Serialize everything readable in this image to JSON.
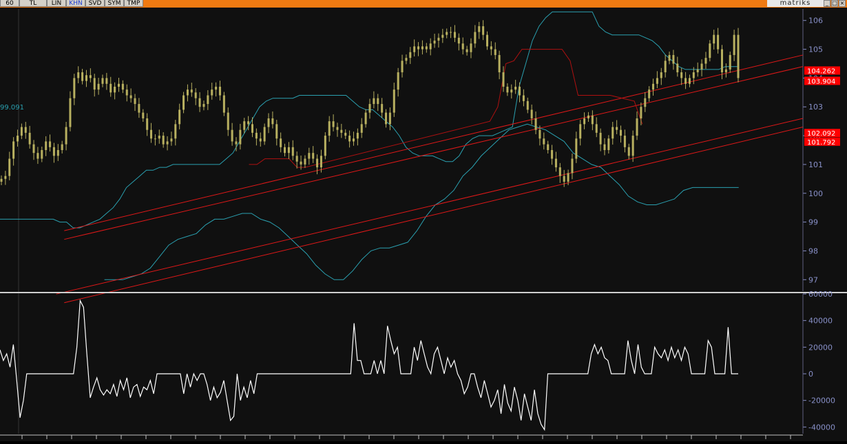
{
  "toolbar": {
    "tabs": [
      {
        "label": "60",
        "active": false
      },
      {
        "label": "TL",
        "active": false
      },
      {
        "label": "LIN",
        "active": false
      },
      {
        "label": "KHN",
        "active": true
      },
      {
        "label": "SVD",
        "active": false
      },
      {
        "label": "SYM",
        "active": false
      },
      {
        "label": "TMP",
        "active": false
      }
    ],
    "brand": "matriks"
  },
  "colors": {
    "background": "#101010",
    "toolbar": "#f07a12",
    "price": "#b8b060",
    "channel": "#e01818",
    "envelope": "#2aa0b0",
    "oscillator": "#ffffff",
    "axis_text": "#8890c8",
    "marker_bg": "#ff0000"
  },
  "chart_data": [
    {
      "type": "candlestick",
      "y_axis": {
        "ylim": [
          96.6,
          106.4
        ],
        "ticks": [
          {
            "value": 97,
            "label": "97"
          },
          {
            "value": 98,
            "label": "98"
          },
          {
            "value": 99,
            "label": "99"
          },
          {
            "value": 100,
            "label": "100"
          },
          {
            "value": 101,
            "label": "101"
          },
          {
            "value": 102,
            "label": "102"
          },
          {
            "value": 103,
            "label": "103"
          },
          {
            "value": 104,
            "label": "104"
          },
          {
            "value": 105,
            "label": "105"
          },
          {
            "value": 106,
            "label": "106"
          }
        ]
      },
      "last_price_markers": [
        {
          "value": 104.262,
          "label": "104.262"
        },
        {
          "value": 103.904,
          "label": "103.904"
        },
        {
          "value": 102.092,
          "label": "102.092"
        },
        {
          "value": 101.792,
          "label": "101.792"
        }
      ],
      "left_label": {
        "value": 103.0,
        "label": "99.091"
      },
      "close": [
        100.5,
        100.6,
        101.2,
        101.8,
        102.0,
        102.3,
        102.1,
        101.7,
        101.4,
        101.2,
        101.5,
        101.8,
        101.6,
        101.3,
        101.5,
        101.7,
        102.3,
        103.3,
        104.0,
        104.2,
        103.9,
        104.1,
        104.0,
        103.6,
        103.8,
        104.0,
        103.8,
        103.5,
        103.7,
        103.8,
        103.6,
        103.4,
        103.3,
        103.1,
        102.8,
        102.6,
        102.2,
        101.9,
        101.9,
        102.0,
        101.7,
        101.8,
        101.9,
        102.4,
        102.9,
        103.4,
        103.6,
        103.5,
        103.3,
        103.0,
        103.1,
        103.4,
        103.6,
        103.7,
        103.4,
        102.8,
        102.2,
        101.8,
        101.7,
        102.2,
        102.5,
        102.4,
        102.1,
        101.9,
        101.8,
        102.3,
        102.6,
        102.4,
        101.9,
        101.6,
        101.4,
        101.6,
        101.3,
        101.1,
        101.0,
        101.2,
        101.4,
        101.2,
        100.9,
        101.3,
        102.0,
        102.5,
        102.3,
        102.2,
        102.1,
        102.0,
        101.8,
        101.9,
        102.1,
        102.4,
        102.8,
        103.1,
        103.3,
        103.1,
        102.8,
        102.4,
        102.8,
        103.6,
        104.2,
        104.6,
        104.7,
        104.9,
        105.1,
        105.0,
        105.1,
        105.0,
        105.2,
        105.3,
        105.4,
        105.5,
        105.6,
        105.6,
        105.4,
        105.2,
        105.0,
        104.9,
        105.2,
        105.6,
        105.8,
        105.5,
        105.1,
        105.0,
        104.8,
        104.2,
        103.7,
        103.5,
        103.6,
        103.7,
        103.4,
        103.2,
        102.9,
        102.6,
        102.2,
        101.9,
        101.7,
        101.5,
        101.2,
        100.9,
        100.6,
        100.4,
        100.7,
        101.2,
        101.9,
        102.4,
        102.6,
        102.7,
        102.4,
        102.1,
        101.7,
        101.5,
        101.9,
        102.3,
        102.2,
        102.0,
        101.6,
        101.3,
        102.0,
        102.6,
        103.0,
        103.3,
        103.6,
        103.8,
        104.0,
        104.2,
        104.6,
        104.8,
        104.5,
        104.2,
        104.0,
        103.8,
        104.0,
        104.2,
        104.3,
        104.5,
        104.7,
        105.2,
        105.5,
        105.0,
        104.2,
        104.3,
        104.8,
        105.5,
        104.0
      ],
      "envelope_upper": [
        99.1,
        99.1,
        99.1,
        99.1,
        99.1,
        99.1,
        99.1,
        99.1,
        99.1,
        99.0,
        99.0,
        98.8,
        98.8,
        98.9,
        99.0,
        99.1,
        99.3,
        99.5,
        99.8,
        100.2,
        100.4,
        100.6,
        100.8,
        100.8,
        100.9,
        100.9,
        101.0,
        101.0,
        101.0,
        101.0,
        101.0,
        101.0,
        101.0,
        101.0,
        101.2,
        101.4,
        101.8,
        102.2,
        102.6,
        103.0,
        103.2,
        103.3,
        103.3,
        103.3,
        103.3,
        103.4,
        103.4,
        103.4,
        103.4,
        103.4,
        103.4,
        103.4,
        103.4,
        103.2,
        103.0,
        102.9,
        102.9,
        102.7,
        102.5,
        102.3,
        102.0,
        101.6,
        101.4,
        101.3,
        101.3,
        101.3,
        101.2,
        101.1,
        101.1,
        101.3,
        101.7,
        101.9,
        102.0,
        102.0,
        102.0,
        102.1,
        102.2,
        102.3,
        103.7,
        104.5,
        105.3,
        105.8,
        106.1,
        106.3,
        106.3,
        106.3,
        106.3,
        106.3,
        106.3,
        106.3,
        105.8,
        105.6,
        105.5,
        105.5,
        105.5,
        105.5,
        105.5,
        105.4,
        105.3,
        105.1,
        104.8,
        104.6,
        104.4,
        104.3,
        104.3,
        104.3,
        104.3,
        104.3,
        104.3,
        104.4,
        104.4,
        104.4
      ],
      "envelope_lower": [
        97.0,
        97.0,
        97.0,
        97.1,
        97.2,
        97.4,
        97.8,
        98.2,
        98.4,
        98.5,
        98.6,
        98.9,
        99.1,
        99.1,
        99.2,
        99.3,
        99.3,
        99.1,
        99.0,
        98.8,
        98.5,
        98.2,
        97.9,
        97.5,
        97.2,
        97.0,
        97.0,
        97.3,
        97.7,
        98.0,
        98.1,
        98.1,
        98.2,
        98.3,
        98.7,
        99.2,
        99.6,
        99.8,
        100.1,
        100.6,
        100.9,
        101.3,
        101.6,
        101.9,
        102.2,
        102.3,
        102.4,
        102.3,
        102.2,
        102.0,
        101.8,
        101.4,
        101.2,
        101.0,
        100.9,
        100.6,
        100.3,
        99.9,
        99.7,
        99.6,
        99.6,
        99.7,
        99.8,
        100.1,
        100.2,
        100.2,
        100.2,
        100.2,
        100.2,
        100.2
      ],
      "channel_lines": [
        {
          "from": [
            0.08,
            98.7
          ],
          "to": [
            1.0,
            104.8
          ]
        },
        {
          "from": [
            0.08,
            98.4
          ],
          "to": [
            1.0,
            104.4
          ]
        },
        {
          "from": [
            0.07,
            96.5
          ],
          "to": [
            1.0,
            102.6
          ]
        },
        {
          "from": [
            0.08,
            96.2
          ],
          "to": [
            1.0,
            102.3
          ]
        }
      ],
      "stop_line": [
        [
          0.31,
          101.0
        ],
        [
          0.32,
          101.0
        ],
        [
          0.33,
          101.2
        ],
        [
          0.36,
          101.2
        ],
        [
          0.37,
          100.9
        ],
        [
          0.38,
          100.9
        ],
        [
          0.61,
          102.5
        ],
        [
          0.61,
          102.5
        ],
        [
          0.62,
          103.0
        ],
        [
          0.63,
          104.5
        ],
        [
          0.64,
          104.6
        ],
        [
          0.65,
          105.0
        ],
        [
          0.7,
          105.0
        ],
        [
          0.71,
          104.6
        ],
        [
          0.72,
          103.4
        ],
        [
          0.76,
          103.4
        ],
        [
          0.79,
          103.2
        ],
        [
          0.8,
          102.4
        ]
      ]
    },
    {
      "type": "line",
      "ylim": [
        -45000,
        60000
      ],
      "y_ticks": [
        {
          "value": 60000,
          "label": "60000"
        },
        {
          "value": 40000,
          "label": "40000"
        },
        {
          "value": 20000,
          "label": "20000"
        },
        {
          "value": 0,
          "label": "0"
        },
        {
          "value": -20000,
          "label": "-20000"
        },
        {
          "value": -40000,
          "label": "-40000"
        }
      ],
      "values": [
        18000,
        10000,
        15000,
        5000,
        22000,
        -5000,
        -33000,
        -20000,
        0,
        0,
        0,
        0,
        0,
        0,
        0,
        0,
        0,
        0,
        0,
        0,
        0,
        0,
        0,
        20000,
        55000,
        50000,
        15000,
        -18000,
        -10000,
        -3000,
        -12000,
        -16000,
        -12000,
        -15000,
        -8000,
        -17000,
        -5000,
        -12000,
        -3000,
        -18000,
        -10000,
        -8000,
        -17000,
        -10000,
        -12000,
        -5000,
        -15000,
        0,
        0,
        0,
        0,
        0,
        0,
        0,
        0,
        -15000,
        0,
        -10000,
        0,
        -5000,
        0,
        0,
        -8000,
        -20000,
        -10000,
        -18000,
        -14000,
        -5000,
        -20000,
        -35000,
        -32000,
        0,
        -20000,
        -10000,
        -18000,
        -5000,
        -15000,
        0,
        0,
        0,
        0,
        0,
        0,
        0,
        0,
        0,
        0,
        0,
        0,
        0,
        0,
        0,
        0,
        0,
        0,
        0,
        0,
        0,
        0,
        0,
        0,
        0,
        0,
        0,
        0,
        0,
        38000,
        10000,
        10000,
        0,
        0,
        0,
        10000,
        0,
        10000,
        0,
        36000,
        25000,
        15000,
        20000,
        0,
        0,
        0,
        0,
        20000,
        10000,
        25000,
        15000,
        5000,
        0,
        15000,
        20000,
        10000,
        0,
        12000,
        5000,
        10000,
        0,
        -5000,
        -15000,
        -10000,
        0,
        0,
        -10000,
        -18000,
        -5000,
        -15000,
        -25000,
        -20000,
        -12000,
        -30000,
        -8000,
        -22000,
        -28000,
        -10000,
        -20000,
        -35000,
        -15000,
        -25000,
        -35000,
        -12000,
        -30000,
        -38000,
        -42000,
        0,
        0,
        0,
        0,
        0,
        0,
        0,
        0,
        0,
        0,
        0,
        0,
        0,
        15000,
        22000,
        15000,
        20000,
        12000,
        10000,
        0,
        0,
        0,
        0,
        0,
        25000,
        10000,
        0,
        22000,
        5000,
        0,
        0,
        0,
        20000,
        15000,
        12000,
        18000,
        10000,
        20000,
        12000,
        18000,
        10000,
        20000,
        15000,
        0,
        0,
        0,
        0,
        0,
        25000,
        20000,
        0,
        0,
        0,
        0,
        35000,
        0,
        0,
        0
      ]
    }
  ]
}
